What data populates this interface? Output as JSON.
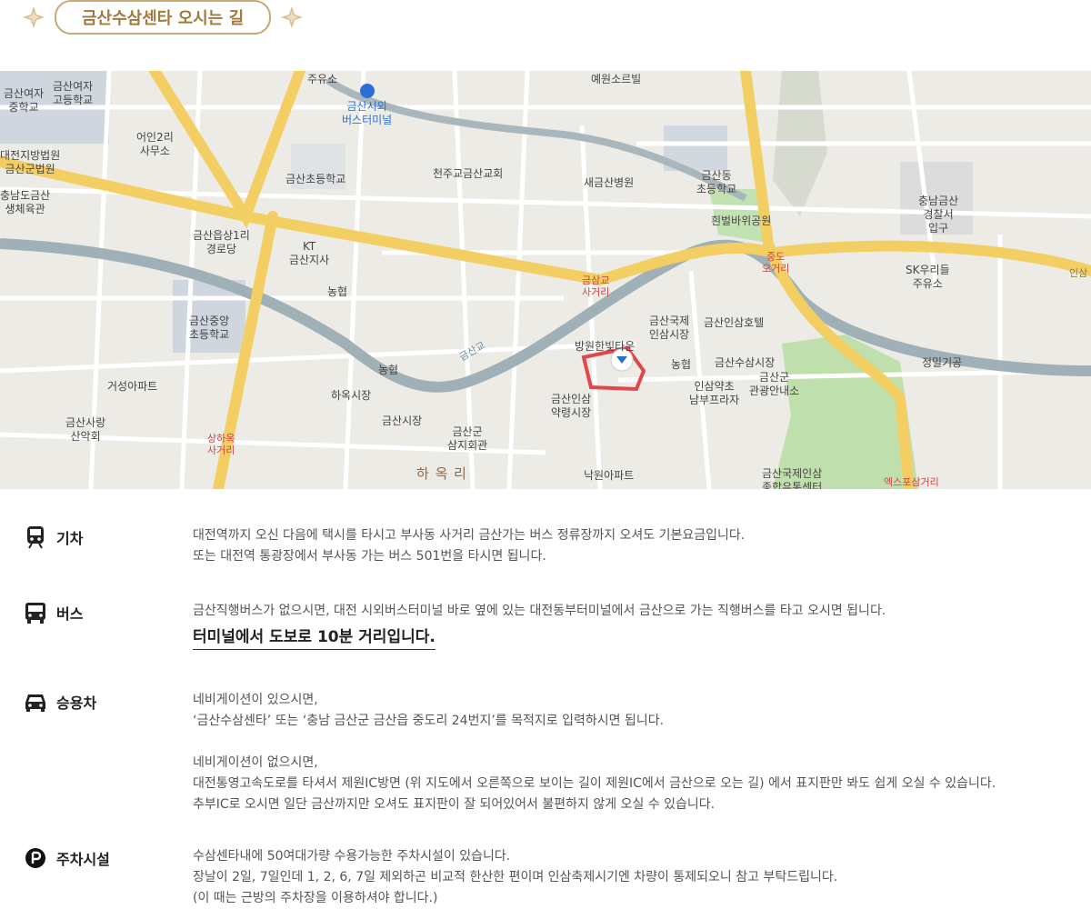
{
  "header": {
    "title": "금산수삼센타 오시는 길",
    "ornament_color": "#c8a874"
  },
  "map": {
    "labels": {
      "l1": "금산여자\n중학교",
      "l2": "금산여자\n고등학교",
      "l3": "어인2리\n사무소",
      "l4": "주유소",
      "l5": "금산시외\n버스터미널",
      "l6": "예원소르빌",
      "l7": "대전지방법원\n금산군법원",
      "l8": "금산초등학교",
      "l9": "천주교금산교회",
      "l10": "새금산병원",
      "l11": "금산동\n초등학교",
      "l12": "충남금산\n경찰서\n입구",
      "l13": "충남도금산\n생체육관",
      "l14": "금산읍상1리\n경로당",
      "l15": "KT\n금산지사",
      "l16": "농협",
      "l17": "금삼교\n사거리",
      "l18": "흰벌바위공원",
      "l19": "중도\n오거리",
      "l20": "SK우리들\n주유소",
      "l21": "금산중앙\n초등학교",
      "l22": "금산국제\n인삼시장",
      "l23": "금산인삼호텔",
      "l24": "방원한빛타운",
      "l25": "금산수삼시장",
      "l26": "정밀기공",
      "l27": "거성아파트",
      "l28": "하옥시장",
      "l29": "농협",
      "l30": "금산인삼\n약령시장",
      "l31": "인삼약초\n남부프라자",
      "l32": "금산군\n관광안내소",
      "l33": "농협",
      "l34": "금산시장",
      "l35": "금산사랑\n산악회",
      "l36": "상하옥\n사거리",
      "l37": "금산군\n삼지회관",
      "l38": "하 옥 리",
      "l39": "낙원아파트",
      "l40": "금산국제인삼\n종합유통센터",
      "l41": "엑스포삼거리",
      "l42": "금산교",
      "l43": "인삼"
    }
  },
  "sections": [
    {
      "title": "기차",
      "icon": "train-icon",
      "lines": [
        "대전역까지 오신 다음에 택시를 타시고 부사동 사거리 금산가는 버스 정류장까지 오셔도 기본요금입니다.",
        "또는 대전역 통광장에서 부사동 가는 버스 501번을 타시면 됩니다."
      ]
    },
    {
      "title": "버스",
      "icon": "bus-icon",
      "lines": [
        "금산직행버스가 없으시면, 대전 시외버스터미널 바로 옆에 있는 대전동부터미널에서 금산으로 가는 직행버스를 타고 오시면 됩니다."
      ],
      "emphasis": "터미널에서 도보로 10분 거리입니다."
    },
    {
      "title": "승용차",
      "icon": "car-icon",
      "lines": [
        "네비게이션이 있으시면,",
        "‘금산수삼센타’ 또는 ‘충남 금산군 금산읍 중도리 24번지’를 목적지로 입력하시면 됩니다.",
        "",
        "네비게이션이 없으시면,",
        "대전통영고속도로를 타셔서 제원IC방면 (위 지도에서 오른쪽으로 보이는 길이 제원IC에서 금산으로 오는 길) 에서 표지판만 봐도 쉽게 오실 수 있습니다.",
        "추부IC로 오시면 일단 금산까지만 오셔도 표지판이 잘 되어있어서 불편하지 않게 오실 수 있습니다."
      ]
    },
    {
      "title": "주차시설",
      "icon": "parking-icon",
      "lines": [
        "수삼센타내에 50여대가량 수용가능한 주차시설이 있습니다.",
        "장날이 2일, 7일인데 1, 2, 6, 7일 제외하곤 비교적 한산한 편이며 인삼축제시기엔 차량이 통제되오니 참고 부탁드립니다.",
        "(이 때는 근방의 주차장을 이용하셔야 합니다.)"
      ]
    }
  ]
}
